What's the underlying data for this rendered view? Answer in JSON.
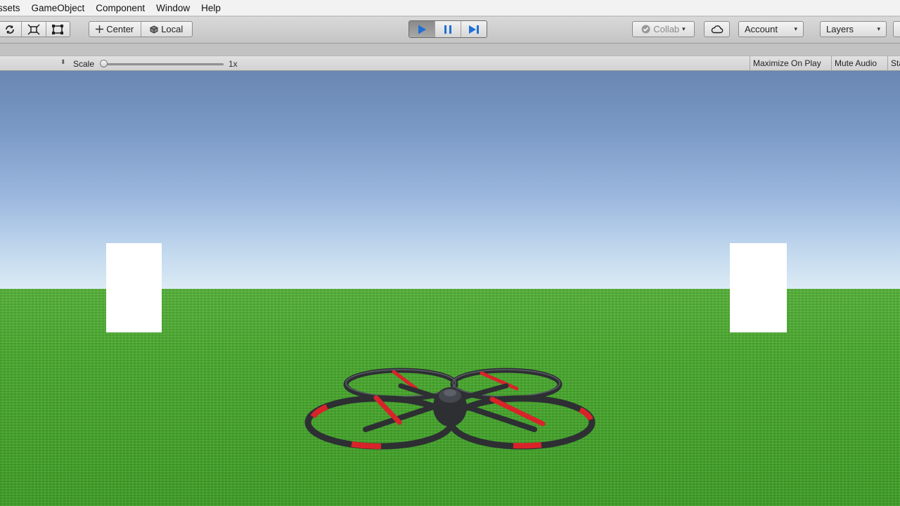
{
  "menu": {
    "items": [
      "ssets",
      "GameObject",
      "Component",
      "Window",
      "Help"
    ]
  },
  "toolbar": {
    "pivot_center": "Center",
    "pivot_local": "Local",
    "collab_label": "Collab",
    "account_label": "Account",
    "layers_label": "Layers",
    "play_state": "playing",
    "play_icon": "play-icon",
    "pause_icon": "pause-icon",
    "step_icon": "step-icon"
  },
  "game_view": {
    "scale_label": "Scale",
    "scale_value": "1x",
    "scale_level": 0,
    "maximize_label": "Maximize On Play",
    "mute_label": "Mute Audio",
    "stats_label": "Sta"
  },
  "colors": {
    "play_accent": "#1f6fd6",
    "sky_top": "#6a86b2",
    "grass": "#4aaa2f",
    "drone_body": "#2d2f33",
    "drone_accent": "#d9232a"
  }
}
